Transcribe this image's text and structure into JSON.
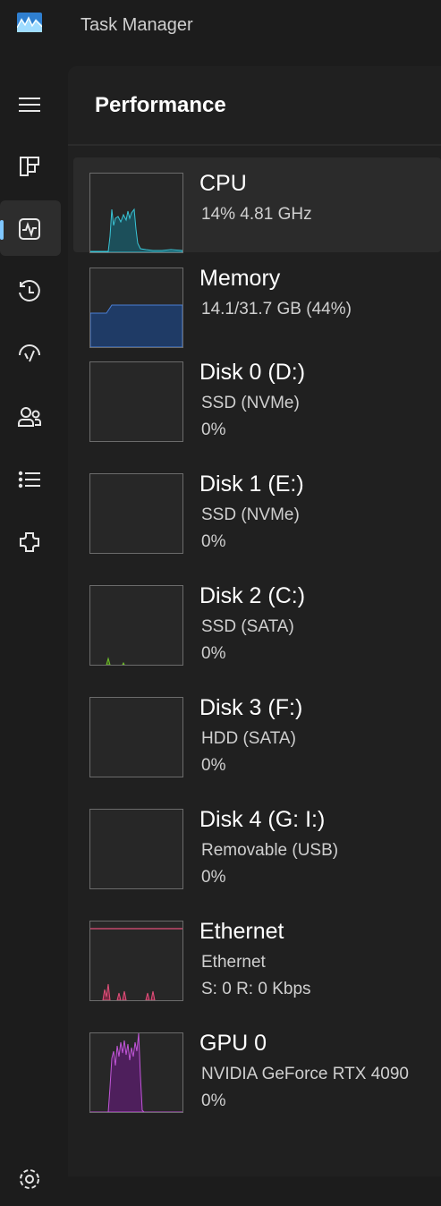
{
  "app": {
    "title": "Task Manager",
    "icon": "task-manager-logo"
  },
  "nav": {
    "items": [
      {
        "icon": "hamburger-menu-icon",
        "active": false
      },
      {
        "icon": "processes-icon",
        "active": false
      },
      {
        "icon": "performance-icon",
        "active": true
      },
      {
        "icon": "app-history-icon",
        "active": false
      },
      {
        "icon": "startup-apps-icon",
        "active": false
      },
      {
        "icon": "users-icon",
        "active": false
      },
      {
        "icon": "details-icon",
        "active": false
      },
      {
        "icon": "services-icon",
        "active": false
      },
      {
        "icon": "settings-icon",
        "active": false
      }
    ]
  },
  "page": {
    "title": "Performance"
  },
  "perf": [
    {
      "name": "CPU",
      "line1": "14%  4.81 GHz",
      "line2": "",
      "color": "#39c5d6"
    },
    {
      "name": "Memory",
      "line1": "14.1/31.7 GB (44%)",
      "line2": "",
      "color": "#4b7fd6"
    },
    {
      "name": "Disk 0 (D:)",
      "line1": "SSD (NVMe)",
      "line2": "0%",
      "color": "#6fbf2a"
    },
    {
      "name": "Disk 1 (E:)",
      "line1": "SSD (NVMe)",
      "line2": "0%",
      "color": "#6fbf2a"
    },
    {
      "name": "Disk 2 (C:)",
      "line1": "SSD (SATA)",
      "line2": "0%",
      "color": "#6fbf2a"
    },
    {
      "name": "Disk 3 (F:)",
      "line1": "HDD (SATA)",
      "line2": "0%",
      "color": "#6fbf2a"
    },
    {
      "name": "Disk 4 (G: I:)",
      "line1": "Removable (USB)",
      "line2": "0%",
      "color": "#6fbf2a"
    },
    {
      "name": "Ethernet",
      "line1": "Ethernet",
      "line2": "S: 0  R: 0 Kbps",
      "color": "#e0507a"
    },
    {
      "name": "GPU 0",
      "line1": "NVIDIA GeForce RTX 4090",
      "line2": "0%",
      "color": "#c156d8"
    }
  ]
}
